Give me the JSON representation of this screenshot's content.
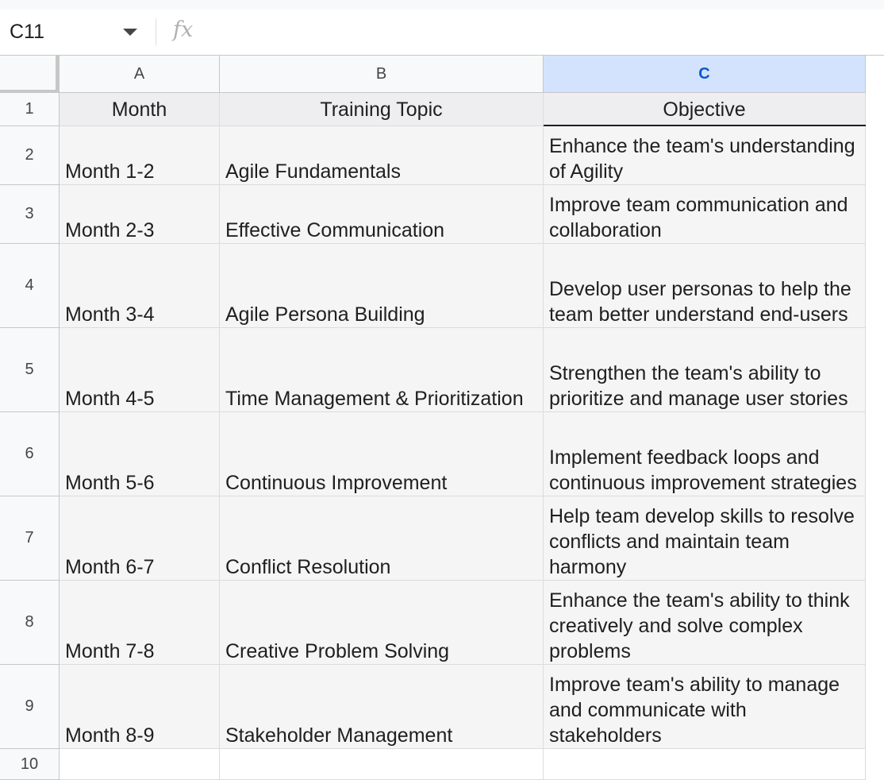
{
  "formula_bar": {
    "cell_ref": "C11",
    "fx_icon": "fx-icon",
    "formula": ""
  },
  "columns": [
    {
      "label": "A"
    },
    {
      "label": "B"
    },
    {
      "label": "C",
      "selected": true
    }
  ],
  "rows": [
    {
      "num": "1",
      "month": "Month",
      "topic": "Training Topic",
      "objective": "Objective"
    },
    {
      "num": "2",
      "month": "Month 1-2",
      "topic": "Agile Fundamentals",
      "objective": "Enhance the team's understanding of Agility"
    },
    {
      "num": "3",
      "month": "Month 2-3",
      "topic": "Effective Communication",
      "objective": "Improve team communication and collaboration"
    },
    {
      "num": "4",
      "month": "Month 3-4",
      "topic": "Agile Persona Building",
      "objective": "Develop user personas to help the team better understand end-users"
    },
    {
      "num": "5",
      "month": "Month 4-5",
      "topic": "Time Management & Prioritization",
      "objective": "Strengthen the team's ability to prioritize and manage user stories"
    },
    {
      "num": "6",
      "month": "Month 5-6",
      "topic": "Continuous Improvement",
      "objective": "Implement feedback loops and continuous improvement strategies"
    },
    {
      "num": "7",
      "month": "Month 6-7",
      "topic": "Conflict Resolution",
      "objective": "Help team develop skills to resolve conflicts and maintain team harmony"
    },
    {
      "num": "8",
      "month": "Month 7-8",
      "topic": "Creative Problem Solving",
      "objective": "Enhance the team's ability to think creatively and solve complex problems"
    },
    {
      "num": "9",
      "month": "Month 8-9",
      "topic": "Stakeholder Management",
      "objective": "Improve team's ability to manage and communicate with stakeholders"
    },
    {
      "num": "10",
      "month": "",
      "topic": "",
      "objective": ""
    }
  ],
  "colors": {
    "selected_header_bg": "#d3e3fd",
    "selected_header_text": "#0b57d0",
    "header_row_bg": "#eeeef0",
    "cell_bg": "#f5f5f5"
  }
}
